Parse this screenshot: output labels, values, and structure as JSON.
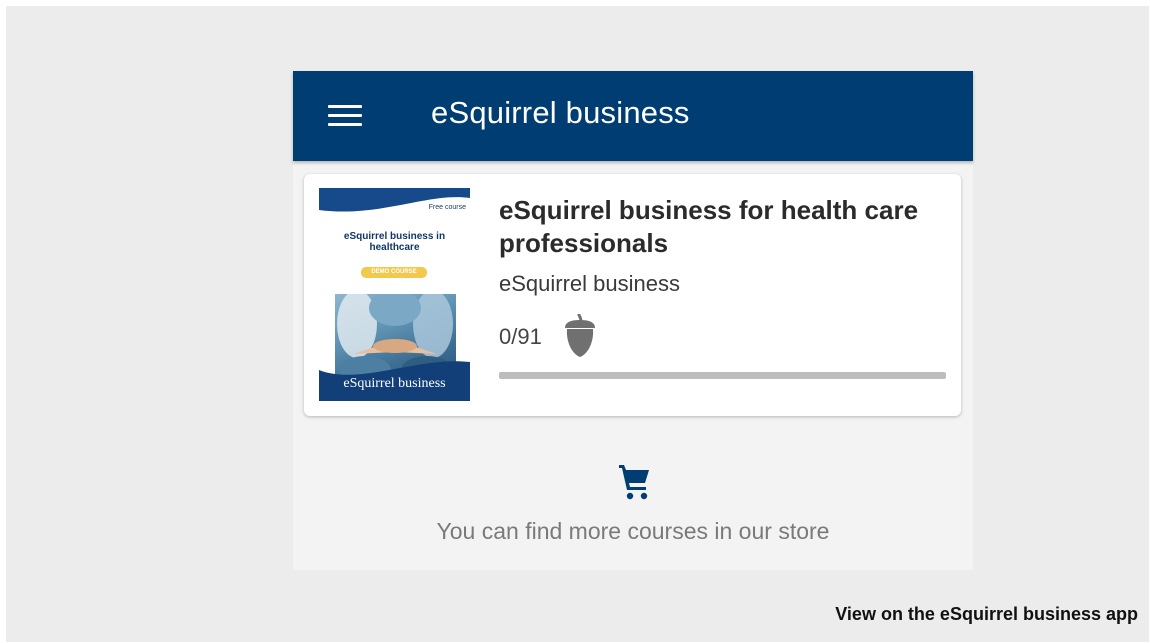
{
  "appbar": {
    "title": "eSquirrel business",
    "menu_icon": "hamburger-menu-icon"
  },
  "course": {
    "title": "eSquirrel business for health care professionals",
    "subtitle": "eSquirrel business",
    "progress_text": "0/91",
    "progress_fraction": 0,
    "acorn_icon": "acorn-icon",
    "thumbnail": {
      "tag": "Free course",
      "title": "eSquirrel business in healthcare",
      "badge": "DEMO COURSE",
      "brand": "eSquirrel business"
    }
  },
  "store": {
    "icon": "shopping-cart-icon",
    "text": "You can find more courses in our store"
  },
  "footer": {
    "link": "View on the eSquirrel business app"
  },
  "colors": {
    "primary": "#003d73",
    "background": "#ececec",
    "progress_track": "#bdbdbd",
    "acorn": "#707070"
  }
}
